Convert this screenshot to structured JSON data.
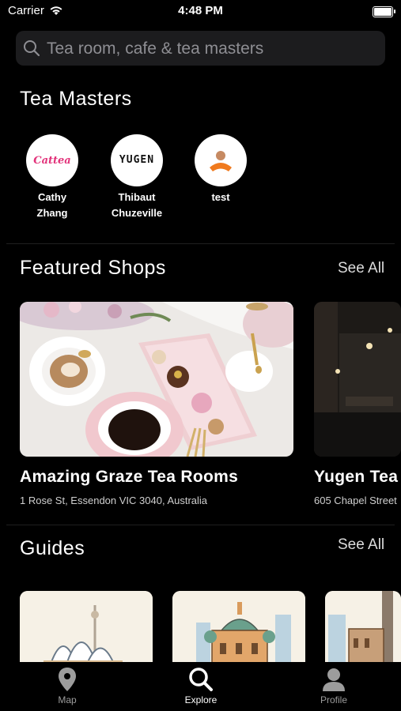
{
  "status_bar": {
    "carrier": "Carrier",
    "time": "4:48 PM"
  },
  "search": {
    "placeholder": "Tea room, cafe & tea masters"
  },
  "tea_masters": {
    "title": "Tea Masters",
    "items": [
      {
        "name_line1": "Cathy",
        "name_line2": "Zhang",
        "logo_text": "Cattea"
      },
      {
        "name_line1": "Thibaut",
        "name_line2": "Chuzeville",
        "logo_text": "YUGEN"
      },
      {
        "name_line1": "test",
        "name_line2": ""
      }
    ]
  },
  "featured": {
    "title": "Featured Shops",
    "see_all": "See All",
    "shops": [
      {
        "name": "Amazing Graze Tea Rooms",
        "address": "1 Rose St, Essendon VIC 3040, Australia"
      },
      {
        "name": "Yugen Tea",
        "address": "605 Chapel Street"
      }
    ]
  },
  "guides": {
    "title": "Guides",
    "see_all": "See All"
  },
  "tabs": [
    {
      "label": "Map",
      "icon": "map-pin-icon",
      "active": false
    },
    {
      "label": "Explore",
      "icon": "search-icon",
      "active": true
    },
    {
      "label": "Profile",
      "icon": "person-icon",
      "active": false
    }
  ]
}
